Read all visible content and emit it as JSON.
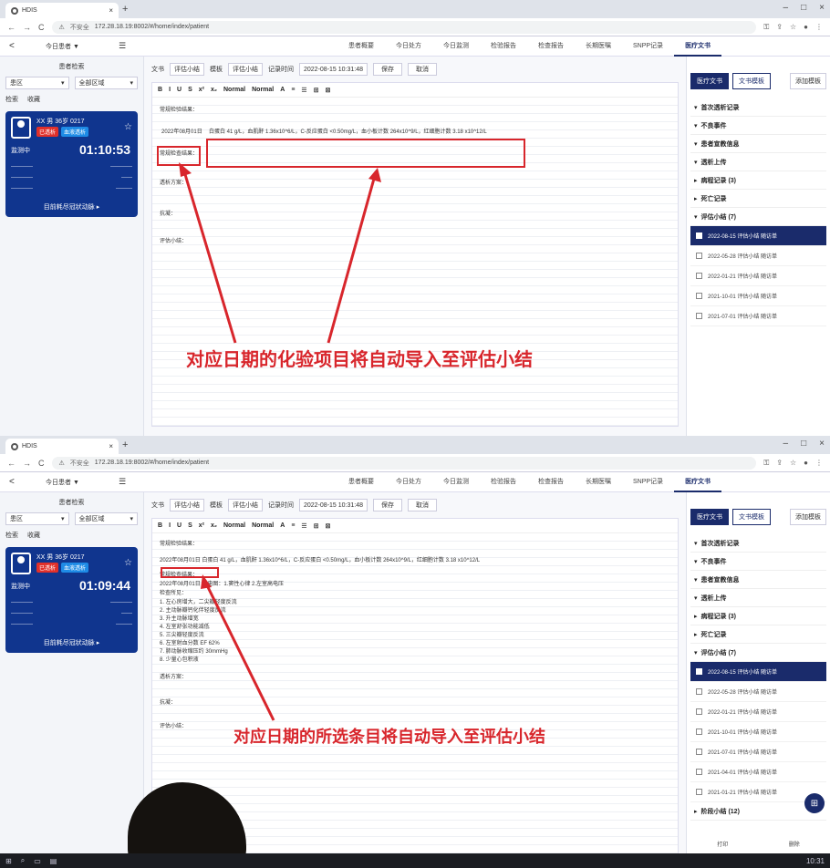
{
  "browser": {
    "tab_title": "HDIS",
    "tab_close": "×",
    "new_tab": "+",
    "url_insecure": "不安全",
    "url_text": "172.28.18.19:8002/#/home/index/patient"
  },
  "header": {
    "back": "<",
    "shift_select": "今日患者 ▼",
    "menu_icon": "☰",
    "tabs": [
      "患者概要",
      "今日处方",
      "今日监测",
      "检验报告",
      "检查报告",
      "长期医嘱",
      "SNPP记录",
      "医疗文书"
    ]
  },
  "left": {
    "title": "患者检索",
    "area_select": "患区",
    "scope_select": "全部区域",
    "subtabs": [
      "检索",
      "收藏"
    ],
    "patient": {
      "name": "XX 男",
      "age": "36岁 0217",
      "badge_red": "已透析",
      "badge_blue": "血液透析",
      "status": "监测中",
      "timer_top": "01:10:53",
      "timer_bottom": "01:09:44",
      "footer": "目前耗尽冠状动脉 ▸"
    }
  },
  "main": {
    "type_label": "文书",
    "type_select": "评估小结",
    "template_label": "模板",
    "template_select": "评估小结",
    "time_label": "记录时间",
    "time_value_top": "2022-08-15 10:31:48",
    "time_value_bottom": "2022-08-15 10:31:48",
    "save_btn": "保存",
    "cancel_btn": "取消",
    "toolbar": [
      "B",
      "I",
      "U",
      "S",
      "x²",
      "x₂",
      "Normal",
      "Normal",
      "A",
      "≡",
      "☰",
      "⊞",
      "⊠"
    ],
    "fields": {
      "lab": "常规检验结果：",
      "ecg": "常规检查结果：",
      "plan": "透析方案：",
      "anticoag": "抗凝：",
      "summary": "评估小结："
    },
    "date_tag": "2022年08月01日",
    "lab_text": "白蛋白 41 g/L，血肌酐 1.36x10^6/L，C-反应蛋白 <0.50mg/L，血小板计数 264x10^9/L，红细胞计数 3.18 x10^12/L",
    "lab_text_bottom": "2022年08月01日 白蛋白 41 g/L，血肌酐 1.36x10^6/L，C-反应蛋白 <0.50mg/L，血小板计数 264x10^9/L，红细胞计数 3.18 x10^12/L",
    "ecg_lines": [
      "2022年08月01日 心电图：1.窦性心律 2.左室高电压",
      "检查所见：",
      "1. 左心房增大，二尖瓣轻度反流",
      "2. 主动脉瓣钙化伴轻度反流",
      "3. 升主动脉增宽",
      "4. 左室舒张功能减低",
      "5. 三尖瓣轻度反流",
      "6. 左室射血分数 EF 62%",
      "7. 肺动脉收缩压约 30mmHg",
      "8. 少量心包积液"
    ]
  },
  "annotations": {
    "top": "对应日期的化验项目将自动导入至评估小结",
    "bottom": "对应日期的所选条目将自动导入至评估小结"
  },
  "right": {
    "tab_active": "医疗文书",
    "tab_other": "文书模板",
    "btn": "添加模板",
    "sections": [
      "首次透析记录",
      "不良事件",
      "患者宣教信息",
      "透析上传",
      "病程记录 (3)",
      "死亡记录",
      "评估小结 (7)"
    ],
    "summary_items": [
      "2022-08-15 评估小结 随访单",
      "2022-05-28 评估小结 随访单",
      "2022-01-21 评估小结 随访单",
      "2021-10-01 评估小结 随访单",
      "2021-07-01 评估小结 随访单",
      "2021-04-01 评估小结 随访单",
      "2021-01-21 评估小结 随访单"
    ],
    "extra_section": "阶段小结 (12)",
    "bottom_tabs": [
      "打印",
      "删除"
    ]
  },
  "taskbar": {
    "start": "⊞",
    "clock": "10:31"
  },
  "colors": {
    "brand": "#1a2b6b",
    "card": "#10358e",
    "annotation": "#d8262c"
  }
}
